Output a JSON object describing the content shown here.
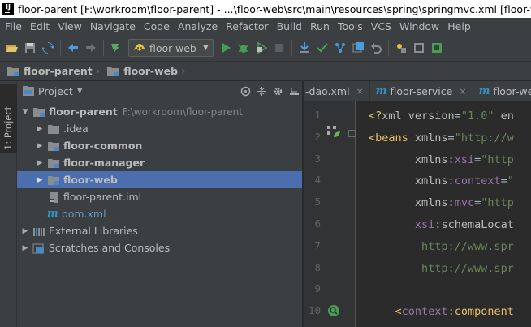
{
  "title_bar": {
    "app_icon": "IJ",
    "title": "floor-parent [F:\\workroom\\floor-parent] - ...\\floor-web\\src\\main\\resources\\spring\\springmvc.xml [floor-web] - IntelliJ IDEA"
  },
  "menu": [
    "File",
    "Edit",
    "View",
    "Navigate",
    "Code",
    "Analyze",
    "Refactor",
    "Build",
    "Run",
    "Tools",
    "VCS",
    "Window",
    "Help"
  ],
  "toolbar": {
    "run_config": "floor-web",
    "icons": [
      "open-icon",
      "save-all-icon",
      "sync-icon",
      "back-icon",
      "forward-icon",
      "build-icon",
      "run-icon",
      "debug-icon",
      "coverage-icon",
      "stop-icon",
      "update-icon",
      "vcs-commit-icon",
      "vcs-push-icon",
      "vcs-history-icon",
      "revert-icon",
      "project-structure-icon",
      "sdk-icon",
      "structure-icon"
    ]
  },
  "breadcrumbs": [
    "floor-parent",
    "floor-web"
  ],
  "tool_stripe": {
    "project_label": "1: Project"
  },
  "project_panel": {
    "title": "Project",
    "tree": [
      {
        "label": "floor-parent",
        "hint": "F:\\workroom\\floor-parent",
        "depth": 0,
        "expanded": true,
        "bold": true,
        "icon": "module-folder-icon"
      },
      {
        "label": ".idea",
        "depth": 1,
        "expanded": false,
        "bold": false,
        "icon": "folder-icon"
      },
      {
        "label": "floor-common",
        "depth": 1,
        "expanded": false,
        "bold": true,
        "icon": "module-folder-icon"
      },
      {
        "label": "floor-manager",
        "depth": 1,
        "expanded": false,
        "bold": true,
        "icon": "module-folder-icon"
      },
      {
        "label": "floor-web",
        "depth": 1,
        "expanded": false,
        "bold": true,
        "icon": "module-folder-icon",
        "selected": true
      },
      {
        "label": "floor-parent.iml",
        "depth": 1,
        "bold": false,
        "icon": "iml-file-icon"
      },
      {
        "label": "pom.xml",
        "depth": 1,
        "bold": false,
        "icon": "maven-icon"
      },
      {
        "label": "External Libraries",
        "depth": 0,
        "expanded": false,
        "bold": false,
        "icon": "libraries-icon"
      },
      {
        "label": "Scratches and Consoles",
        "depth": 0,
        "expanded": false,
        "bold": false,
        "icon": "scratches-icon"
      }
    ]
  },
  "editor": {
    "tabs": [
      {
        "label": "-dao.xml",
        "maven": false
      },
      {
        "label": "floor-service",
        "maven": true
      },
      {
        "label": "floor-web",
        "maven": true
      }
    ],
    "line_numbers": [
      "1",
      "2",
      "3",
      "4",
      "5",
      "6",
      "7",
      "8",
      "9",
      "10"
    ],
    "lines": [
      [
        {
          "t": "<?",
          "c": "pi"
        },
        {
          "t": "xml version",
          "c": "attr"
        },
        {
          "t": "=",
          "c": "plain"
        },
        {
          "t": "\"1.0\"",
          "c": "str"
        },
        {
          "t": " en",
          "c": "attr"
        }
      ],
      [
        {
          "t": "<beans ",
          "c": "tag"
        },
        {
          "t": "xmlns",
          "c": "attr"
        },
        {
          "t": "=",
          "c": "plain"
        },
        {
          "t": "\"http://w",
          "c": "str"
        }
      ],
      [
        {
          "t": "       ",
          "c": "plain"
        },
        {
          "t": "xmlns",
          "c": "attr"
        },
        {
          "t": ":",
          "c": "plain"
        },
        {
          "t": "xsi",
          "c": "ns"
        },
        {
          "t": "=",
          "c": "plain"
        },
        {
          "t": "\"http",
          "c": "str"
        }
      ],
      [
        {
          "t": "       ",
          "c": "plain"
        },
        {
          "t": "xmlns",
          "c": "attr"
        },
        {
          "t": ":",
          "c": "plain"
        },
        {
          "t": "context",
          "c": "ns"
        },
        {
          "t": "=",
          "c": "plain"
        },
        {
          "t": "\"",
          "c": "str"
        }
      ],
      [
        {
          "t": "       ",
          "c": "plain"
        },
        {
          "t": "xmlns",
          "c": "attr"
        },
        {
          "t": ":",
          "c": "plain"
        },
        {
          "t": "mvc",
          "c": "ns"
        },
        {
          "t": "=",
          "c": "plain"
        },
        {
          "t": "\"http",
          "c": "str"
        }
      ],
      [
        {
          "t": "       ",
          "c": "plain"
        },
        {
          "t": "xsi",
          "c": "ns"
        },
        {
          "t": ":",
          "c": "plain"
        },
        {
          "t": "schemaLocat",
          "c": "attr"
        }
      ],
      [
        {
          "t": "        ",
          "c": "plain"
        },
        {
          "t": "http://www.spr",
          "c": "str"
        }
      ],
      [
        {
          "t": "        ",
          "c": "plain"
        },
        {
          "t": "http://www.spr",
          "c": "str"
        }
      ],
      [],
      [
        {
          "t": "    ",
          "c": "plain"
        },
        {
          "t": "<",
          "c": "tag"
        },
        {
          "t": "context",
          "c": "ns"
        },
        {
          "t": ":",
          "c": "tag"
        },
        {
          "t": "component",
          "c": "tag"
        }
      ]
    ]
  }
}
